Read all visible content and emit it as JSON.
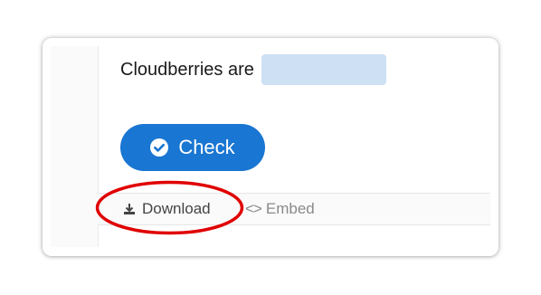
{
  "exercise": {
    "prompt_text": "Cloudberries are",
    "answer_value": "",
    "check_label": "Check"
  },
  "footer": {
    "download_label": "Download",
    "embed_label": "Embed",
    "embed_icon": "<>"
  },
  "icons": {
    "check": "check-circle-icon",
    "download": "download-icon",
    "embed": "code-icon"
  },
  "colors": {
    "primary_button": "#1976d2",
    "answer_box": "#cde0f4",
    "highlight_ring": "#e00000"
  }
}
